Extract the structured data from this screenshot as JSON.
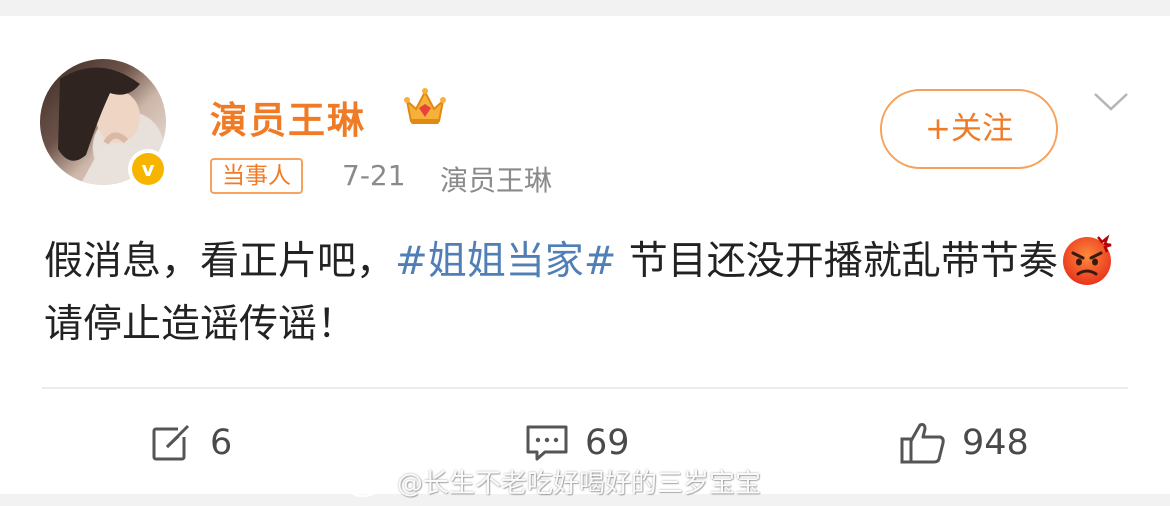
{
  "post": {
    "username": "演员王琳",
    "tag": "当事人",
    "date": "7-21",
    "source": "演员王琳",
    "follow_label": "+关注",
    "text_part1": "假消息，看正片吧，",
    "hashtag": "#姐姐当家#",
    "text_part2": " 节目还没开播就乱带节奏",
    "text_part3": "请停止造谣传谣！",
    "emoji": "angry-face"
  },
  "actions": {
    "share_count": "6",
    "comment_count": "69",
    "like_count": "948"
  },
  "watermark": {
    "text": "@长生不老吃好喝好的三岁宝宝"
  },
  "colors": {
    "accent": "#f07b26",
    "hashtag": "#4f7fb5",
    "verified": "#f7b500"
  }
}
